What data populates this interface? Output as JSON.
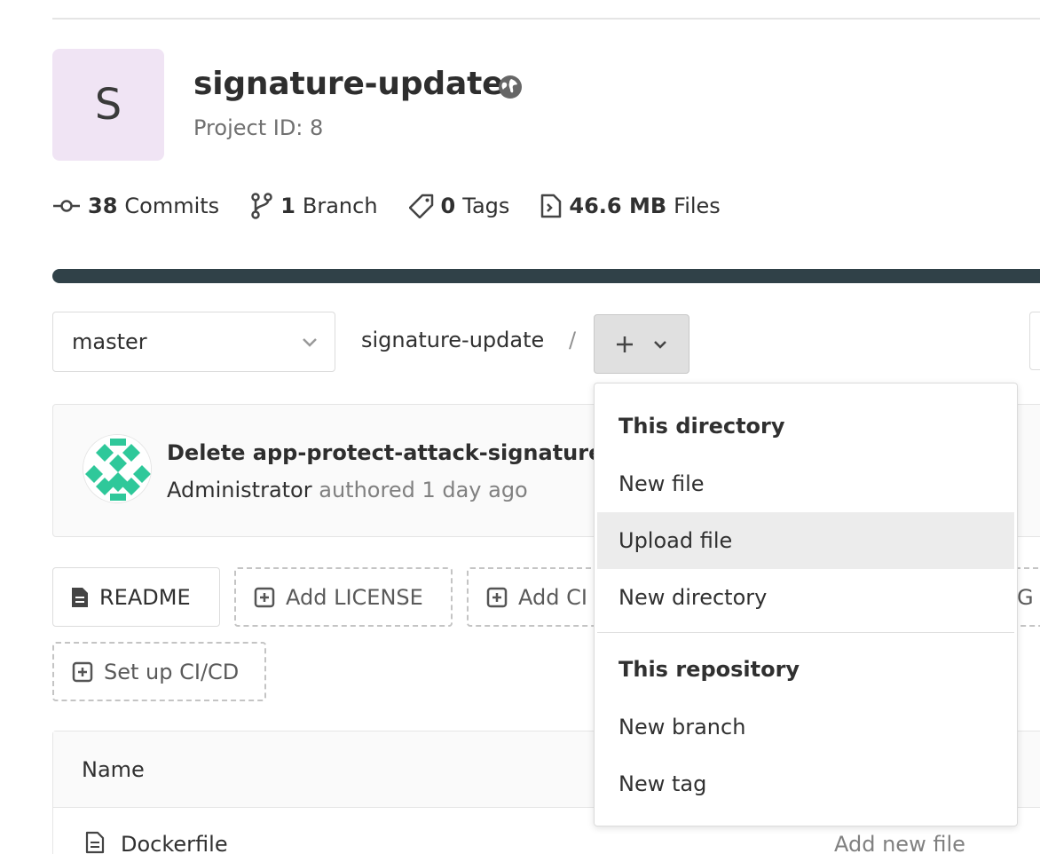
{
  "project": {
    "avatar_letter": "S",
    "name": "signature-update",
    "id_label": "Project ID: 8"
  },
  "stats": {
    "commits": {
      "count": "38",
      "label": "Commits"
    },
    "branches": {
      "count": "1",
      "label": "Branch"
    },
    "tags": {
      "count": "0",
      "label": "Tags"
    },
    "files": {
      "count": "46.6 MB",
      "label": "Files"
    }
  },
  "toolbar": {
    "branch": "master",
    "path_root": "signature-update",
    "path_separator": "/"
  },
  "commit": {
    "title": "Delete app-protect-attack-signatures-",
    "author": "Administrator",
    "authored_text": "authored 1 day ago"
  },
  "quick_actions": {
    "readme": "README",
    "add_license": "Add LICENSE",
    "add_ci": "Add CI",
    "right_cut": "G",
    "setup_cicd": "Set up CI/CD"
  },
  "file_table": {
    "header_name": "Name",
    "rows": [
      {
        "name": "Dockerfile",
        "last_commit": "Add new file"
      }
    ]
  },
  "add_menu": {
    "section_directory": "This directory",
    "new_file": "New file",
    "upload_file": "Upload file",
    "new_directory": "New directory",
    "section_repository": "This repository",
    "new_branch": "New branch",
    "new_tag": "New tag",
    "highlighted_item": "Upload file"
  },
  "colors": {
    "avatar_bg": "#f0e4f4",
    "progress_bar": "#304148",
    "identicon": "#2fc89a"
  }
}
